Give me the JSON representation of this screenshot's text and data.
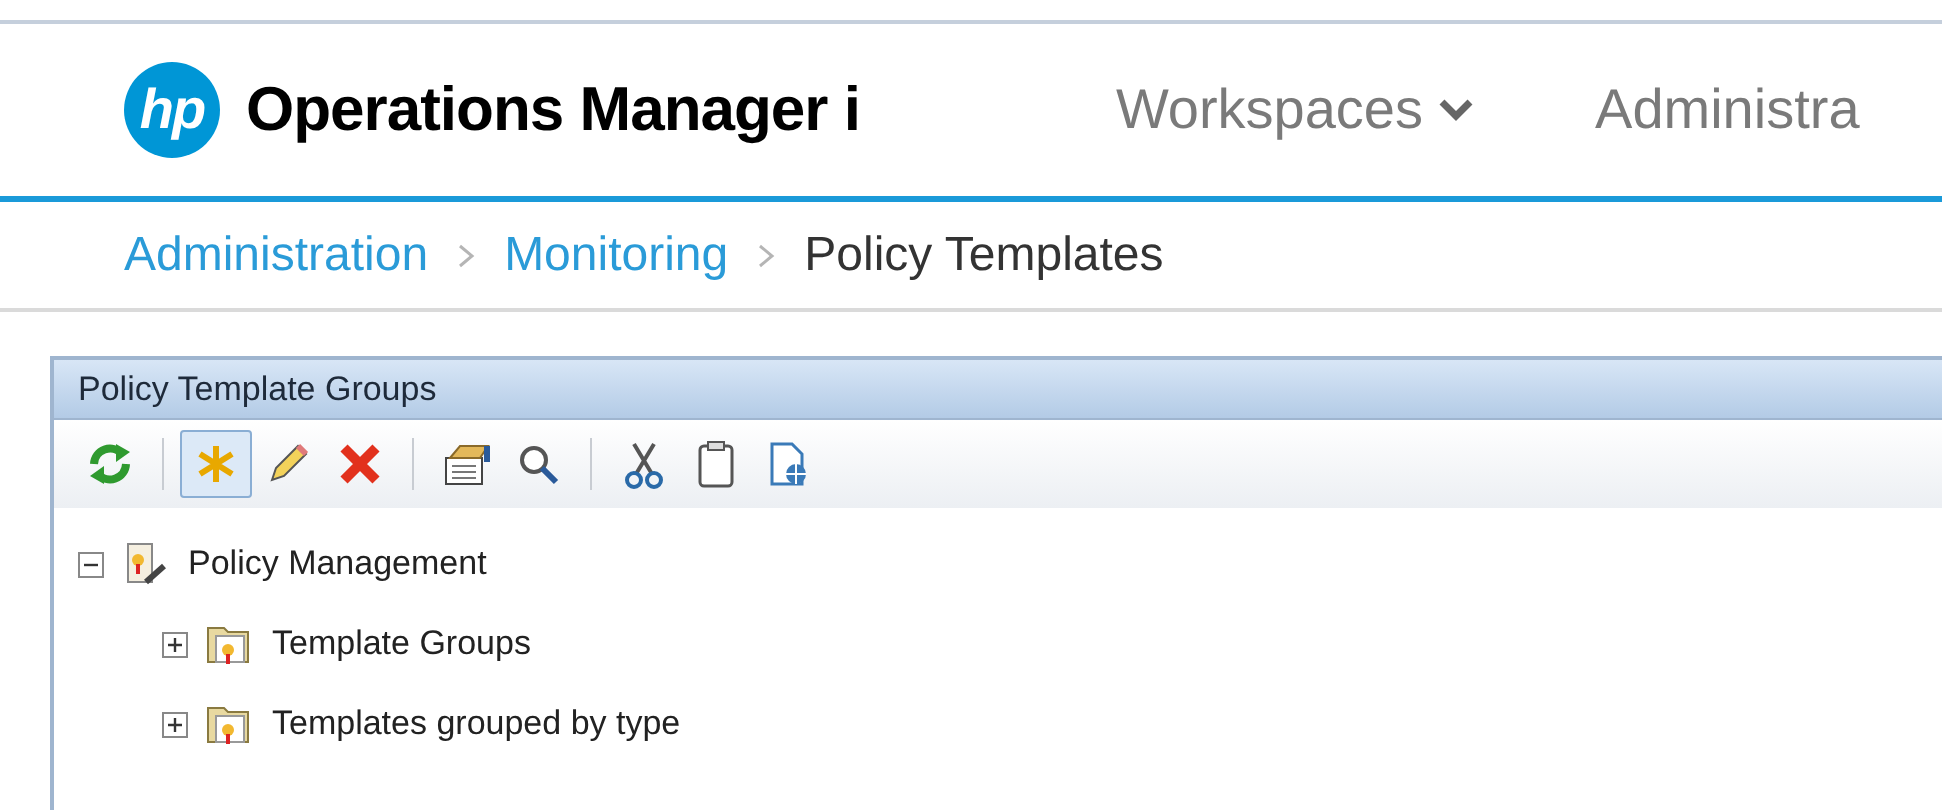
{
  "header": {
    "logo": "hp",
    "title": "Operations Manager i",
    "nav": [
      {
        "label": "Workspaces",
        "dropdown": true
      },
      {
        "label": "Administra",
        "dropdown": false
      }
    ]
  },
  "breadcrumb": [
    {
      "label": "Administration",
      "link": true
    },
    {
      "label": "Monitoring",
      "link": true
    },
    {
      "label": "Policy Templates",
      "link": false
    }
  ],
  "panel": {
    "title": "Policy Template Groups",
    "toolbar": [
      [
        {
          "kind": "refresh",
          "pressed": false
        }
      ],
      [
        {
          "kind": "new",
          "pressed": true
        },
        {
          "kind": "edit",
          "pressed": false
        },
        {
          "kind": "delete",
          "pressed": false
        }
      ],
      [
        {
          "kind": "properties",
          "pressed": false
        },
        {
          "kind": "search",
          "pressed": false
        }
      ],
      [
        {
          "kind": "cut",
          "pressed": false
        },
        {
          "kind": "paste",
          "pressed": false
        },
        {
          "kind": "import",
          "pressed": false
        }
      ]
    ],
    "tree": [
      {
        "label": "Policy Management",
        "kind": "root",
        "expanded": true,
        "children": [
          {
            "label": "Template Groups",
            "kind": "folder",
            "expanded": false
          },
          {
            "label": "Templates grouped by type",
            "kind": "folder",
            "expanded": false
          }
        ]
      }
    ]
  }
}
